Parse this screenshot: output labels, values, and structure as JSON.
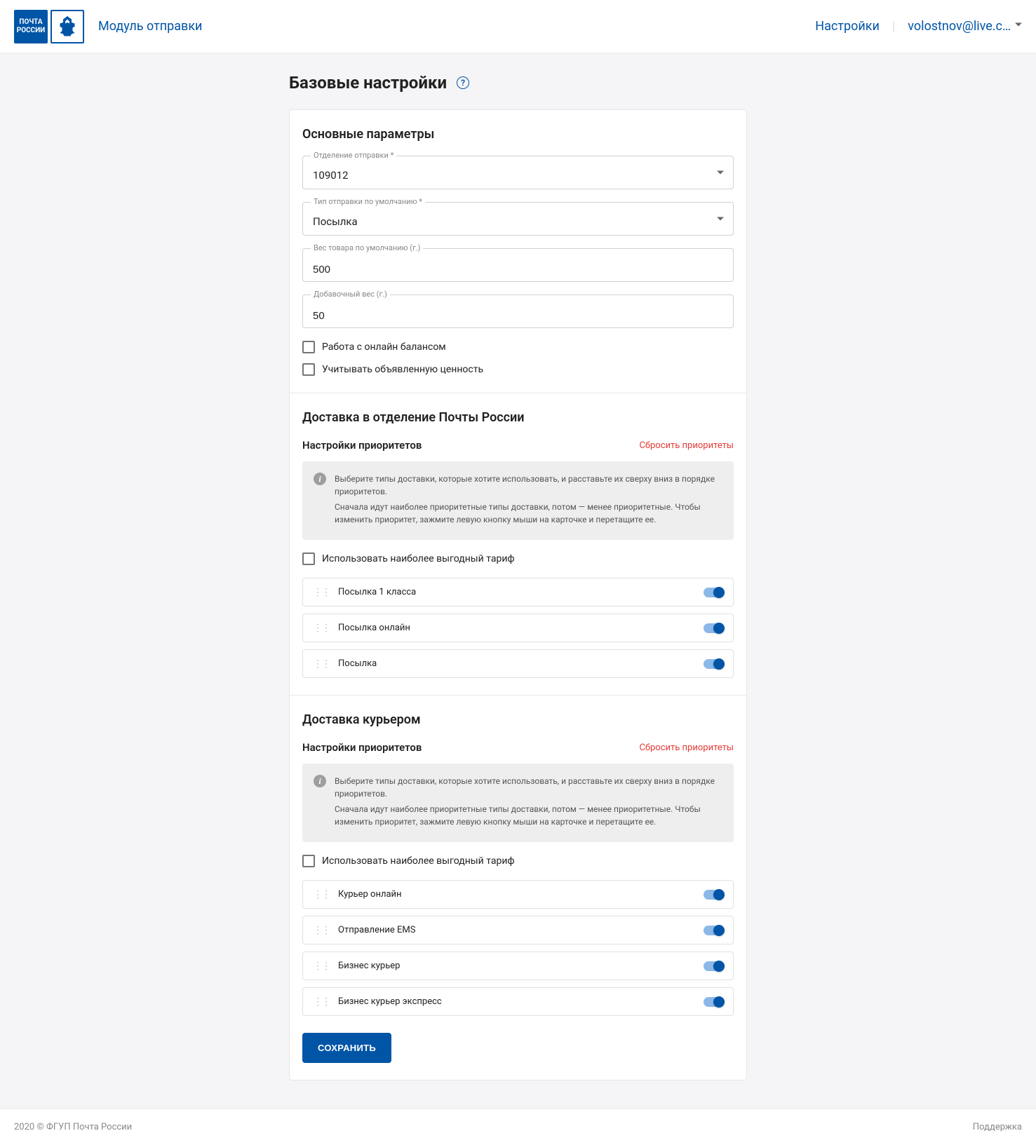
{
  "header": {
    "logoLine1": "ПОЧТА",
    "logoLine2": "РОССИИ",
    "moduleLink": "Модуль отправки",
    "settingsLink": "Настройки",
    "userEmail": "volostnov@live.c…"
  },
  "page": {
    "title": "Базовые настройки"
  },
  "mainParams": {
    "title": "Основные параметры",
    "departmentLabel": "Отделение отправки *",
    "departmentValue": "109012",
    "typeLabel": "Тип отправки по умолчанию *",
    "typeValue": "Посылка",
    "weightLabel": "Вес товара по умолчанию (г.)",
    "weightValue": "500",
    "extraWeightLabel": "Добавочный вес (г.)",
    "extraWeightValue": "50",
    "onlineBalance": "Работа с онлайн балансом",
    "declaredValue": "Учитывать объявленную ценность"
  },
  "pickupDelivery": {
    "title": "Доставка в отделение Почты России",
    "prioritiesTitle": "Настройки приоритетов",
    "resetLink": "Сбросить приоритеты",
    "infoLine1": "Выберите типы доставки, которые хотите использовать, и расставьте их сверху вниз в порядке приоритетов.",
    "infoLine2": "Сначала идут наиболее приоритетные типы доставки, потом — менее приоритетные. Чтобы изменить приоритет, зажмите левую кнопку мыши на карточке и перетащите ее.",
    "useBestTariff": "Использовать наиболее выгодный тариф",
    "items": [
      {
        "label": "Посылка 1 класса"
      },
      {
        "label": "Посылка онлайн"
      },
      {
        "label": "Посылка"
      }
    ]
  },
  "courierDelivery": {
    "title": "Доставка курьером",
    "prioritiesTitle": "Настройки приоритетов",
    "resetLink": "Сбросить приоритеты",
    "infoLine1": "Выберите типы доставки, которые хотите использовать, и расставьте их сверху вниз в порядке приоритетов.",
    "infoLine2": "Сначала идут наиболее приоритетные типы доставки, потом — менее приоритетные. Чтобы изменить приоритет, зажмите левую кнопку мыши на карточке и перетащите ее.",
    "useBestTariff": "Использовать наиболее выгодный тариф",
    "items": [
      {
        "label": "Курьер онлайн"
      },
      {
        "label": "Отправление EMS"
      },
      {
        "label": "Бизнес курьер"
      },
      {
        "label": "Бизнес курьер экспресс"
      }
    ]
  },
  "saveButton": "СОХРАНИТЬ",
  "footer": {
    "copyright": "2020 © ФГУП Почта России",
    "support": "Поддержка"
  }
}
